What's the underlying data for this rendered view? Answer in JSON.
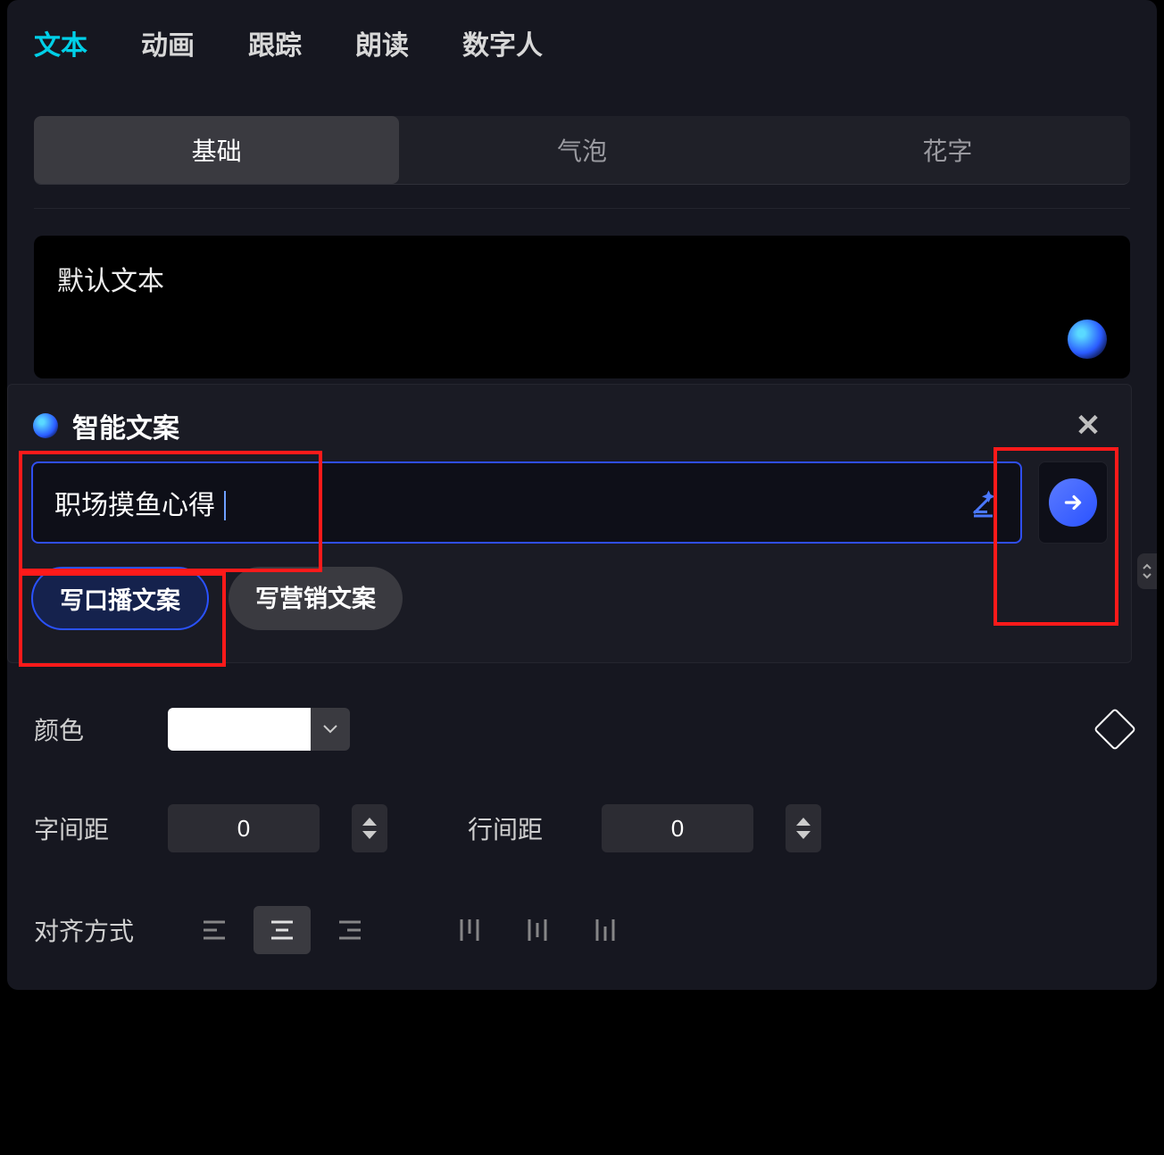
{
  "topnav": {
    "tabs": [
      "文本",
      "动画",
      "跟踪",
      "朗读",
      "数字人"
    ],
    "active": 0
  },
  "subtabs": {
    "tabs": [
      "基础",
      "气泡",
      "花字"
    ],
    "active": 0
  },
  "textbox": {
    "value": "默认文本"
  },
  "popup": {
    "title": "智能文案",
    "input_value": "职场摸鱼心得",
    "chips": [
      "写口播文案",
      "写营销文案"
    ],
    "chip_active": 0
  },
  "form": {
    "color_label": "颜色",
    "color_value": "#ffffff",
    "letter_spacing_label": "字间距",
    "letter_spacing_value": "0",
    "line_spacing_label": "行间距",
    "line_spacing_value": "0",
    "align_label": "对齐方式"
  }
}
